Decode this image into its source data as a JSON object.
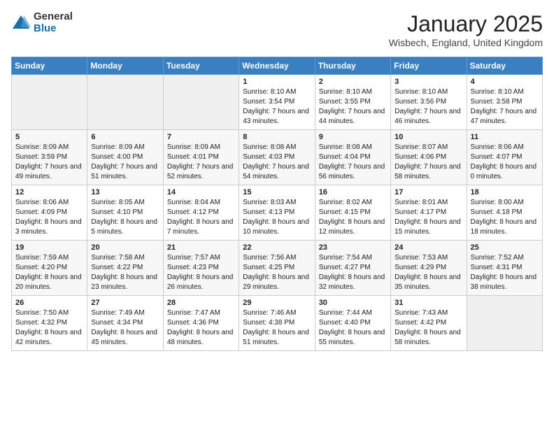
{
  "logo": {
    "general": "General",
    "blue": "Blue"
  },
  "header": {
    "month": "January 2025",
    "location": "Wisbech, England, United Kingdom"
  },
  "weekdays": [
    "Sunday",
    "Monday",
    "Tuesday",
    "Wednesday",
    "Thursday",
    "Friday",
    "Saturday"
  ],
  "weeks": [
    [
      {
        "day": "",
        "info": ""
      },
      {
        "day": "",
        "info": ""
      },
      {
        "day": "",
        "info": ""
      },
      {
        "day": "1",
        "info": "Sunrise: 8:10 AM\nSunset: 3:54 PM\nDaylight: 7 hours and 43 minutes."
      },
      {
        "day": "2",
        "info": "Sunrise: 8:10 AM\nSunset: 3:55 PM\nDaylight: 7 hours and 44 minutes."
      },
      {
        "day": "3",
        "info": "Sunrise: 8:10 AM\nSunset: 3:56 PM\nDaylight: 7 hours and 46 minutes."
      },
      {
        "day": "4",
        "info": "Sunrise: 8:10 AM\nSunset: 3:58 PM\nDaylight: 7 hours and 47 minutes."
      }
    ],
    [
      {
        "day": "5",
        "info": "Sunrise: 8:09 AM\nSunset: 3:59 PM\nDaylight: 7 hours and 49 minutes."
      },
      {
        "day": "6",
        "info": "Sunrise: 8:09 AM\nSunset: 4:00 PM\nDaylight: 7 hours and 51 minutes."
      },
      {
        "day": "7",
        "info": "Sunrise: 8:09 AM\nSunset: 4:01 PM\nDaylight: 7 hours and 52 minutes."
      },
      {
        "day": "8",
        "info": "Sunrise: 8:08 AM\nSunset: 4:03 PM\nDaylight: 7 hours and 54 minutes."
      },
      {
        "day": "9",
        "info": "Sunrise: 8:08 AM\nSunset: 4:04 PM\nDaylight: 7 hours and 56 minutes."
      },
      {
        "day": "10",
        "info": "Sunrise: 8:07 AM\nSunset: 4:06 PM\nDaylight: 7 hours and 58 minutes."
      },
      {
        "day": "11",
        "info": "Sunrise: 8:06 AM\nSunset: 4:07 PM\nDaylight: 8 hours and 0 minutes."
      }
    ],
    [
      {
        "day": "12",
        "info": "Sunrise: 8:06 AM\nSunset: 4:09 PM\nDaylight: 8 hours and 3 minutes."
      },
      {
        "day": "13",
        "info": "Sunrise: 8:05 AM\nSunset: 4:10 PM\nDaylight: 8 hours and 5 minutes."
      },
      {
        "day": "14",
        "info": "Sunrise: 8:04 AM\nSunset: 4:12 PM\nDaylight: 8 hours and 7 minutes."
      },
      {
        "day": "15",
        "info": "Sunrise: 8:03 AM\nSunset: 4:13 PM\nDaylight: 8 hours and 10 minutes."
      },
      {
        "day": "16",
        "info": "Sunrise: 8:02 AM\nSunset: 4:15 PM\nDaylight: 8 hours and 12 minutes."
      },
      {
        "day": "17",
        "info": "Sunrise: 8:01 AM\nSunset: 4:17 PM\nDaylight: 8 hours and 15 minutes."
      },
      {
        "day": "18",
        "info": "Sunrise: 8:00 AM\nSunset: 4:18 PM\nDaylight: 8 hours and 18 minutes."
      }
    ],
    [
      {
        "day": "19",
        "info": "Sunrise: 7:59 AM\nSunset: 4:20 PM\nDaylight: 8 hours and 20 minutes."
      },
      {
        "day": "20",
        "info": "Sunrise: 7:58 AM\nSunset: 4:22 PM\nDaylight: 8 hours and 23 minutes."
      },
      {
        "day": "21",
        "info": "Sunrise: 7:57 AM\nSunset: 4:23 PM\nDaylight: 8 hours and 26 minutes."
      },
      {
        "day": "22",
        "info": "Sunrise: 7:56 AM\nSunset: 4:25 PM\nDaylight: 8 hours and 29 minutes."
      },
      {
        "day": "23",
        "info": "Sunrise: 7:54 AM\nSunset: 4:27 PM\nDaylight: 8 hours and 32 minutes."
      },
      {
        "day": "24",
        "info": "Sunrise: 7:53 AM\nSunset: 4:29 PM\nDaylight: 8 hours and 35 minutes."
      },
      {
        "day": "25",
        "info": "Sunrise: 7:52 AM\nSunset: 4:31 PM\nDaylight: 8 hours and 38 minutes."
      }
    ],
    [
      {
        "day": "26",
        "info": "Sunrise: 7:50 AM\nSunset: 4:32 PM\nDaylight: 8 hours and 42 minutes."
      },
      {
        "day": "27",
        "info": "Sunrise: 7:49 AM\nSunset: 4:34 PM\nDaylight: 8 hours and 45 minutes."
      },
      {
        "day": "28",
        "info": "Sunrise: 7:47 AM\nSunset: 4:36 PM\nDaylight: 8 hours and 48 minutes."
      },
      {
        "day": "29",
        "info": "Sunrise: 7:46 AM\nSunset: 4:38 PM\nDaylight: 8 hours and 51 minutes."
      },
      {
        "day": "30",
        "info": "Sunrise: 7:44 AM\nSunset: 4:40 PM\nDaylight: 8 hours and 55 minutes."
      },
      {
        "day": "31",
        "info": "Sunrise: 7:43 AM\nSunset: 4:42 PM\nDaylight: 8 hours and 58 minutes."
      },
      {
        "day": "",
        "info": ""
      }
    ]
  ]
}
